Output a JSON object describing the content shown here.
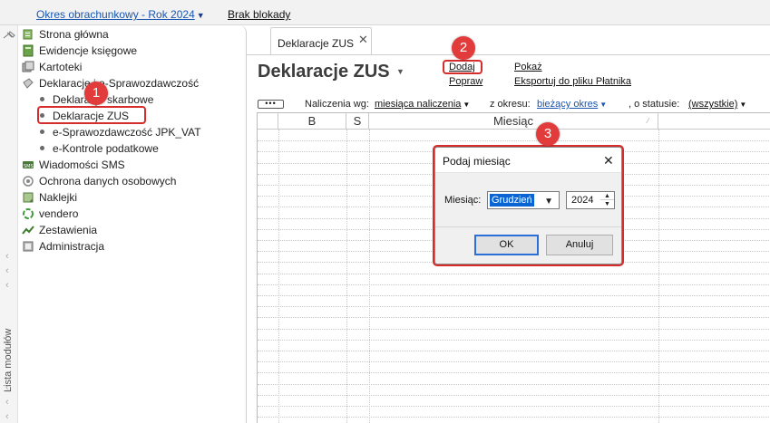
{
  "topbar": {
    "period_label": "Okres obrachunkowy - Rok 2024",
    "lock_label": "Brak blokady"
  },
  "left_strip": {
    "label": "Lista modułów"
  },
  "nav": {
    "items": [
      {
        "label": "Strona główna",
        "icon": "home-icon"
      },
      {
        "label": "Ewidencje księgowe",
        "icon": "books-icon"
      },
      {
        "label": "Kartoteki",
        "icon": "cards-icon"
      },
      {
        "label": "Deklaracje i e-Sprawozdawczość",
        "icon": "declarations-icon"
      },
      {
        "label": "Deklaracje skarbowe",
        "icon": "bullet"
      },
      {
        "label": "Deklaracje ZUS",
        "icon": "bullet"
      },
      {
        "label": "e-Sprawozdawczość JPK_VAT",
        "icon": "bullet"
      },
      {
        "label": "e-Kontrole podatkowe",
        "icon": "bullet"
      },
      {
        "label": "Wiadomości SMS",
        "icon": "sms-icon"
      },
      {
        "label": "Ochrona danych osobowych",
        "icon": "shield-icon"
      },
      {
        "label": "Naklejki",
        "icon": "stickers-icon"
      },
      {
        "label": "vendero",
        "icon": "vendero-icon"
      },
      {
        "label": "Zestawienia",
        "icon": "reports-icon"
      },
      {
        "label": "Administracja",
        "icon": "admin-icon"
      }
    ]
  },
  "tab": {
    "label": "Deklaracje ZUS",
    "close": "✕"
  },
  "main": {
    "title": "Deklaracje ZUS",
    "actions": {
      "add": "Dodaj",
      "edit": "Popraw",
      "show": "Pokaż",
      "export": "Eksportuj do pliku Płatnika"
    },
    "filters": {
      "more": "•••",
      "calc_label": "Naliczenia wg:",
      "calc_value": "miesiąca naliczenia",
      "period_label": "z okresu:",
      "period_value": "bieżący okres",
      "status_label": ", o statusie:",
      "status_value": "(wszystkie)"
    },
    "grid": {
      "columns": [
        "B",
        "S",
        "Miesiąc"
      ]
    }
  },
  "dialog": {
    "title": "Podaj miesiąc",
    "close": "✕",
    "month_label": "Miesiąc:",
    "month_value": "Grudzień",
    "year_value": "2024",
    "ok_label": "OK",
    "cancel_label": "Anuluj"
  },
  "callouts": [
    "1",
    "2",
    "3"
  ],
  "colors": {
    "highlight": "#d62c2c",
    "link_blue": "#1a56b0",
    "selection_blue": "#0a64d4"
  }
}
